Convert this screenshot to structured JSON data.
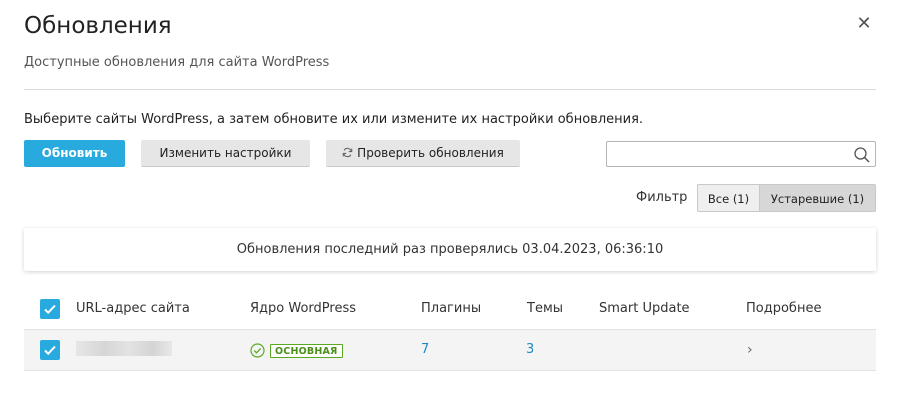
{
  "dialog": {
    "title": "Обновления",
    "subtitle": "Доступные обновления для сайта WordPress",
    "close_icon": "close-icon"
  },
  "intro": "Выберите сайты WordPress, а затем обновите их или измените их настройки обновления.",
  "toolbar": {
    "update_label": "Обновить",
    "settings_label": "Изменить настройки",
    "check_label": "Проверить обновления",
    "check_icon": "refresh-icon",
    "search": {
      "value": "",
      "placeholder": "",
      "icon": "search-icon"
    }
  },
  "filter": {
    "label": "Фильтр",
    "options": [
      "Все (1)",
      "Устаревшие (1)"
    ],
    "selected": "Устаревшие (1)"
  },
  "notice": "Обновления последний раз проверялись 03.04.2023, 06:36:10",
  "table": {
    "columns": [
      "URL-адрес сайта",
      "Ядро WordPress",
      "Плагины",
      "Темы",
      "Smart Update",
      "Подробнее"
    ],
    "select_all_checked": true,
    "rows": [
      {
        "checked": true,
        "url": "",
        "core_status": "ОСНОВНАЯ",
        "plugins": "7",
        "themes": "3",
        "smart_update": "",
        "details_icon": "chevron-right-icon"
      }
    ]
  },
  "colors": {
    "accent": "#28aade",
    "link": "#1f8ac0",
    "status_ok": "#5ca823"
  }
}
